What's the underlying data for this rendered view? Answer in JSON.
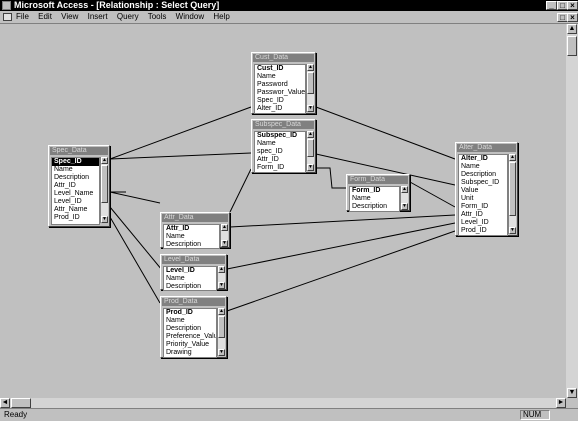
{
  "window": {
    "title": "Microsoft Access - [Relationship : Select Query]"
  },
  "menu": [
    "File",
    "Edit",
    "View",
    "Insert",
    "Query",
    "Tools",
    "Window",
    "Help"
  ],
  "status": {
    "text": "Ready",
    "num": "NUM"
  },
  "tables": {
    "cust": {
      "title": "Cust_Data",
      "fields": [
        "Cust_ID",
        "Name",
        "Password",
        "Passwor_Value",
        "Spec_ID",
        "Alter_ID"
      ],
      "key": 0
    },
    "subspec": {
      "title": "Subspec_Data",
      "fields": [
        "Subspec_ID",
        "Name",
        "spec_ID",
        "Attr_ID",
        "Form_ID"
      ],
      "key": 0
    },
    "spec": {
      "title": "Spec_Data",
      "fields": [
        "Spec_ID",
        "Name",
        "Description",
        "Attr_ID",
        "Level_Name",
        "Level_ID",
        "Attr_Name",
        "Prod_ID"
      ],
      "key": 0
    },
    "form": {
      "title": "Form_Data",
      "fields": [
        "Form_ID",
        "Name",
        "Description"
      ],
      "key": 0
    },
    "alter": {
      "title": "Alter_Data",
      "fields": [
        "Alter_ID",
        "Name",
        "Description",
        "Subspec_ID",
        "Value",
        "Unit",
        "Form_ID",
        "Attr_ID",
        "Level_ID",
        "Prod_ID"
      ],
      "key": 0
    },
    "attr": {
      "title": "Attr_Data",
      "fields": [
        "Attr_ID",
        "Name",
        "Description"
      ],
      "key": 0
    },
    "level": {
      "title": "Level_Data",
      "fields": [
        "Level_ID",
        "Name",
        "Description"
      ],
      "key": 0
    },
    "prod": {
      "title": "Prod_Data",
      "fields": [
        "Prod_ID",
        "Name",
        "Description",
        "Preference_Value",
        "Priority_Value",
        "Drawing"
      ],
      "key": 0
    }
  }
}
